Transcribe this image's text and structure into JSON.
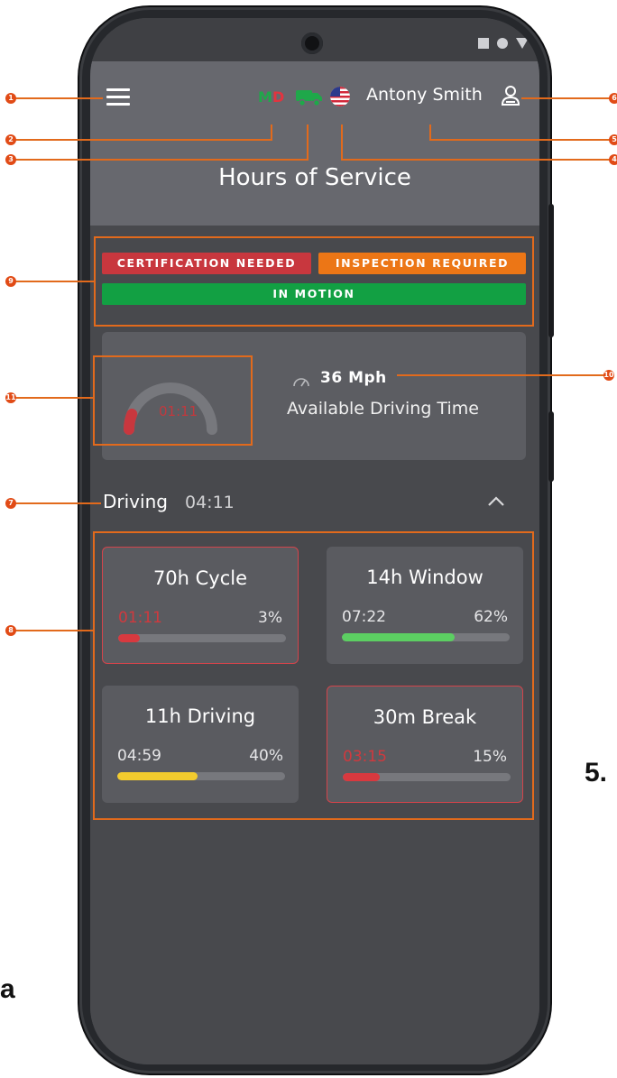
{
  "header": {
    "status_m": "M",
    "status_d": "D",
    "user_name": "Antony Smith",
    "title": "Hours of Service"
  },
  "alerts": {
    "certification": "CERTIFICATION NEEDED",
    "inspection": "INSPECTION REQUIRED",
    "motion": "IN MOTION"
  },
  "speed_card": {
    "gauge_time": "01:11",
    "gauge_level": 0.12,
    "speed": "36 Mph",
    "label": "Available Driving Time"
  },
  "driving": {
    "label": "Driving",
    "time": "04:11"
  },
  "tiles": [
    {
      "title": "70h Cycle",
      "time": "01:11",
      "percent": "3%",
      "fill": 0.13,
      "color": "#d8393f",
      "alert": true
    },
    {
      "title": "14h Window",
      "time": "07:22",
      "percent": "62%",
      "fill": 0.67,
      "color": "#5ccf62",
      "alert": false
    },
    {
      "title": "11h Driving",
      "time": "04:59",
      "percent": "40%",
      "fill": 0.48,
      "color": "#f2cb2e",
      "alert": false
    },
    {
      "title": "30m Break",
      "time": "03:15",
      "percent": "15%",
      "fill": 0.22,
      "color": "#d8393f",
      "alert": true
    }
  ],
  "annotations": [
    "1",
    "2",
    "3",
    "4",
    "5",
    "6",
    "7",
    "8",
    "9",
    "10",
    "11"
  ],
  "outside_text": {
    "right": "5.",
    "left": "a"
  },
  "colors": {
    "header": "#67686e",
    "screen": "#48494d",
    "card": "#5a5b60",
    "badge_red": "#c8373e",
    "badge_orange": "#ec7616",
    "badge_green": "#12a043",
    "annotation": "#e26a1c"
  },
  "icons": [
    "menu-icon",
    "truck-icon",
    "us-flag-icon",
    "user-icon",
    "speedometer-icon",
    "chevron-up-icon"
  ]
}
